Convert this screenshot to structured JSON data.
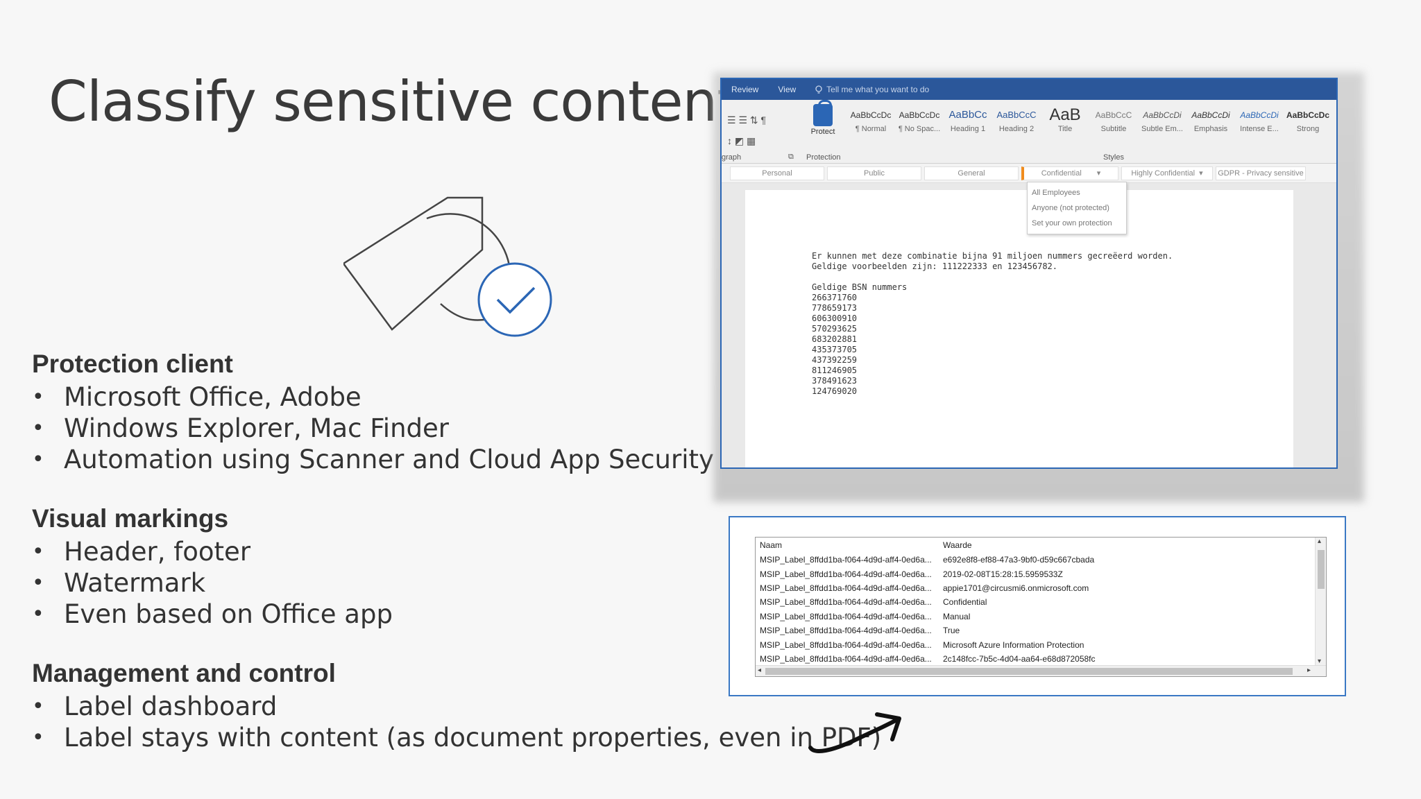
{
  "slide": {
    "title": "Classify sensitive content"
  },
  "sections": [
    {
      "heading": "Protection client",
      "items": [
        "Microsoft Office, Adobe",
        "Windows Explorer, Mac Finder",
        "Automation using Scanner and Cloud App Security"
      ]
    },
    {
      "heading": "Visual markings",
      "items": [
        "Header, footer",
        "Watermark",
        "Even based on Office app"
      ]
    },
    {
      "heading": "Management and control",
      "items": [
        "Label dashboard",
        "Label stays with content (as document properties, even in PDF)"
      ]
    }
  ],
  "word": {
    "tabs": [
      "Review",
      "View"
    ],
    "tell_me": "Tell me what you want to do",
    "protect_label": "Protect",
    "group_paragraph": "graph",
    "group_protection": "Protection",
    "group_styles": "Styles",
    "styles": [
      {
        "sample": "AaBbCcDc",
        "name": "¶ Normal"
      },
      {
        "sample": "AaBbCcDc",
        "name": "¶ No Spac..."
      },
      {
        "sample": "AaBbCc",
        "name": "Heading 1"
      },
      {
        "sample": "AaBbCcC",
        "name": "Heading 2"
      },
      {
        "sample": "AaB",
        "name": "Title"
      },
      {
        "sample": "AaBbCcC",
        "name": "Subtitle"
      },
      {
        "sample": "AaBbCcDi",
        "name": "Subtle Em..."
      },
      {
        "sample": "AaBbCcDi",
        "name": "Emphasis"
      },
      {
        "sample": "AaBbCcDi",
        "name": "Intense E..."
      },
      {
        "sample": "AaBbCcDc",
        "name": "Strong"
      }
    ],
    "labels": [
      "Personal",
      "Public",
      "General",
      "Confidential",
      "Highly Confidential",
      "GDPR - Privacy sensitive"
    ],
    "dropdown": [
      "All Employees",
      "Anyone (not protected)",
      "Set your own protection"
    ],
    "doc_lines": [
      "Er kunnen met deze combinatie bijna 91 miljoen nummers gecreëerd worden.",
      "Geldige voorbeelden zijn: 111222333 en 123456782.",
      "",
      "Geldige BSN nummers",
      "266371760",
      "778659173",
      "606300910",
      "570293625",
      "683202881",
      "435373705",
      "437392259",
      "811246905",
      "378491623",
      "124769020"
    ]
  },
  "props": {
    "col_name": "Naam",
    "col_value": "Waarde",
    "rows": [
      {
        "name": "MSIP_Label_8ffdd1ba-f064-4d9d-aff4-0ed6a...",
        "value": "e692e8f8-ef88-47a3-9bf0-d59c667cbada"
      },
      {
        "name": "MSIP_Label_8ffdd1ba-f064-4d9d-aff4-0ed6a...",
        "value": "2019-02-08T15:28:15.5959533Z"
      },
      {
        "name": "MSIP_Label_8ffdd1ba-f064-4d9d-aff4-0ed6a...",
        "value": "appie1701@circusmi6.onmicrosoft.com"
      },
      {
        "name": "MSIP_Label_8ffdd1ba-f064-4d9d-aff4-0ed6a...",
        "value": "Confidential"
      },
      {
        "name": "MSIP_Label_8ffdd1ba-f064-4d9d-aff4-0ed6a...",
        "value": "Manual"
      },
      {
        "name": "MSIP_Label_8ffdd1ba-f064-4d9d-aff4-0ed6a...",
        "value": "True"
      },
      {
        "name": "MSIP_Label_8ffdd1ba-f064-4d9d-aff4-0ed6a...",
        "value": "Microsoft Azure Information Protection"
      },
      {
        "name": "MSIP_Label_8ffdd1ba-f064-4d9d-aff4-0ed6a...",
        "value": "2c148fcc-7b5c-4d04-aa64-e68d872058fc"
      }
    ]
  },
  "colors": {
    "accent_blue": "#2b66b5",
    "ribbon_blue": "#2b579a",
    "label_orange": "#f08c1e"
  }
}
